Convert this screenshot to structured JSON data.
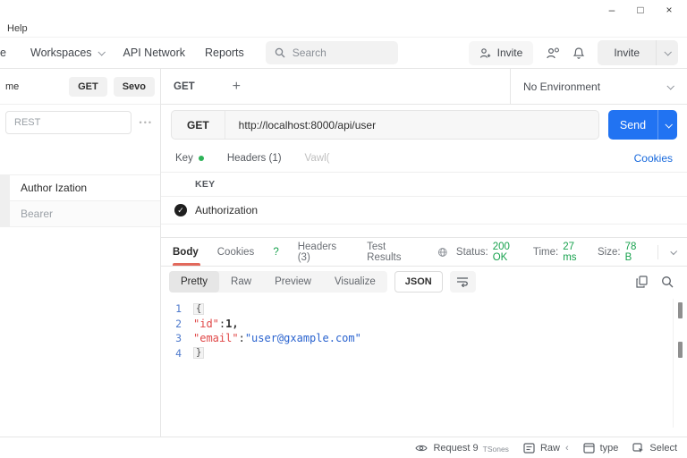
{
  "titlebar": {
    "minimize": "–",
    "maximize": "□",
    "close": "×"
  },
  "menubar": {
    "items": [
      "Help"
    ]
  },
  "navbar": {
    "home_partial": "e",
    "workspaces": "Workspaces",
    "api_network": "API Network",
    "reports": "Reports",
    "search_placeholder": "Search",
    "invite_ghost": "Invite",
    "invite_primary": "Invite"
  },
  "sidebar": {
    "header_label": "me",
    "get_button": "GET",
    "save_button": "Sevo",
    "filter_value": "REST",
    "more_dots": "•••",
    "items": [
      {
        "label": "Author Ization"
      },
      {
        "label": "Bearer"
      }
    ]
  },
  "request": {
    "tab_method": "GET",
    "new_tab": "+",
    "environment": "No Environment",
    "method": "GET",
    "url": "http://localhost:8000/api/user",
    "send_label": "Send"
  },
  "req_tabs": {
    "key": "Key",
    "headers": "Headers (1)",
    "vault": "Vawl(",
    "cookies_link": "Cookies"
  },
  "params": {
    "key_header": "KEY",
    "check_glyph": "✓",
    "row_label": "Authorization"
  },
  "response": {
    "tab_body": "Body",
    "tab_cookies": "Cookies",
    "tab_help": "?",
    "tab_headers": "Headers (3)",
    "tab_tests": "Test Results",
    "status_label": "Status:",
    "status_value": "200 OK",
    "time_label": "Time:",
    "time_value": "27 ms",
    "size_label": "Size:",
    "size_value": "78 B"
  },
  "format_bar": {
    "views": [
      "Pretty",
      "Raw",
      "Preview",
      "Visualize"
    ],
    "language": "JSON"
  },
  "code": {
    "lines": [
      {
        "num": "1",
        "tokens": [
          {
            "t": "{",
            "c": "brace"
          }
        ]
      },
      {
        "num": "2",
        "tokens": [
          {
            "t": "\"id\"",
            "c": "key"
          },
          {
            "t": ": ",
            "c": "plain"
          },
          {
            "t": "1,",
            "c": "num"
          }
        ]
      },
      {
        "num": "3",
        "tokens": [
          {
            "t": "\"email\"",
            "c": "key"
          },
          {
            "t": ": ",
            "c": "plain"
          },
          {
            "t": "\"user@gxample.com\"",
            "c": "str"
          }
        ]
      },
      {
        "num": "4",
        "tokens": [
          {
            "t": "}",
            "c": "brace"
          }
        ]
      }
    ]
  },
  "statusbar": {
    "request_label": "Request 9",
    "request_sub": "TSones",
    "raw_label": "Raw",
    "back_glyph": "‹",
    "type_label": "type",
    "select_label": "Select"
  },
  "colors": {
    "accent_blue": "#2173f2",
    "link_blue": "#1668dc",
    "green_text": "#18a24e",
    "green_dot": "#2eb358",
    "tab_underline": "#e2695c",
    "json_key": "#e04848",
    "json_string": "#2a63cf",
    "line_number": "#4d79cc"
  }
}
